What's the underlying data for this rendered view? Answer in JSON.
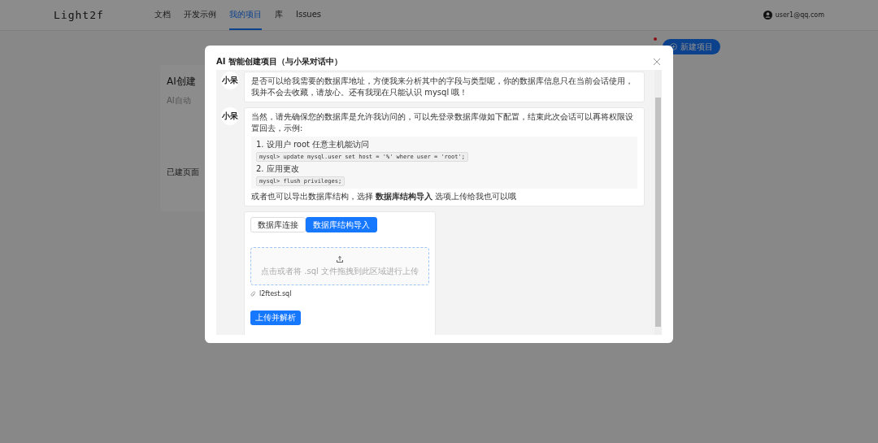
{
  "header": {
    "logo": "Light2f",
    "nav": [
      {
        "label": "文档",
        "selected": false
      },
      {
        "label": "开发示例",
        "selected": false
      },
      {
        "label": "我的项目",
        "selected": true
      },
      {
        "label": "库",
        "selected": false
      },
      {
        "label": "Issues",
        "selected": false
      }
    ],
    "user": "user1@qq.com"
  },
  "background_card": {
    "title": "AI创建",
    "subtitle": "AI自动",
    "pages_label": "已建页面"
  },
  "new_project_button": {
    "label": "新建项目"
  },
  "modal": {
    "title": "AI 智能创建项目（与小呆对话中）",
    "messages": [
      {
        "sender": "小呆",
        "blocks": [
          {
            "kind": "text",
            "text": "是否可以给我需要的数据库地址，方便我来分析其中的字段与类型呢，你的数据库信息只在当前会话使用，我并不会去收藏，请放心。还有我现在只能认识 mysql 哦！"
          }
        ]
      },
      {
        "sender": "小呆",
        "blocks": [
          {
            "kind": "text",
            "text": "当然，请先确保您的数据库是允许我访问的，可以先登录数据库做如下配置，结束此次会话可以再将权限设置回去，示例:"
          },
          {
            "kind": "steps",
            "items": [
              {
                "text": "1. 设用户 root 任意主机能访问",
                "code": "mysql> update mysql.user set host = '%' where user = 'root';"
              },
              {
                "text": "2. 应用更改",
                "code": "mysql> flush privileges;"
              }
            ]
          },
          {
            "kind": "text",
            "text": "或者也可以导出数据库结构，选择 **数据库结构导入** 选项上传给我也可以哦"
          }
        ]
      }
    ],
    "upload": {
      "tabs": [
        {
          "label": "数据库连接",
          "selected": false
        },
        {
          "label": "数据库结构导入",
          "selected": true
        }
      ],
      "dropzone_hint": "点击或者将 .sql 文件拖拽到此区域进行上传",
      "file": "l2ftest.sql",
      "submit": "上传并解析"
    }
  }
}
